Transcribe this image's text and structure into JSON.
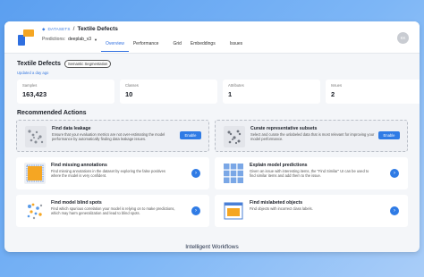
{
  "app": {
    "breadcrumb_link": "DATASETS",
    "breadcrumb_sep": "/",
    "dataset_title": "Textile Defects",
    "predictions_label": "Predictions:",
    "predictions_value": "deeplab_v3",
    "avatar_initials": "KK"
  },
  "tabs": [
    {
      "label": "Overview",
      "active": true
    },
    {
      "label": "Performance",
      "active": false
    },
    {
      "label": "Grid",
      "active": false
    },
    {
      "label": "Embeddings",
      "active": false
    },
    {
      "label": "Issues",
      "active": false
    }
  ],
  "dataset": {
    "name": "Textile Defects",
    "task_badge": "Semantic Segmentation",
    "updated": "Updated a day ago"
  },
  "stats": [
    {
      "label": "Samples",
      "value": "163,423"
    },
    {
      "label": "Classes",
      "value": "10"
    },
    {
      "label": "Attributes",
      "value": "1"
    },
    {
      "label": "Issues",
      "value": "2"
    }
  ],
  "recommended": {
    "title": "Recommended Actions",
    "cards": [
      {
        "title": "Find data leakage",
        "desc": "Ensure that your evaluation metrics are not over-estimating the model performance by automatically finding data leakage issues.",
        "action": "Enable",
        "icon": "scatter-gray-icon"
      },
      {
        "title": "Curate representative subsets",
        "desc": "Select and curate the unlabeled data that is most relevant for improving your model performance.",
        "action": "Enable",
        "icon": "scatter-cluster-icon"
      },
      {
        "title": "Find missing annotations",
        "desc": "Find missing annotations in the dataset by exploring the false positives where the model is very confident.",
        "action": "arrow",
        "icon": "missing-annotation-icon"
      },
      {
        "title": "Explain model predictions",
        "desc": "Given an issue with interesting items, the \"Find Similar\" UI can be used to find similar items and add them to the issue.",
        "action": "arrow",
        "icon": "grid-tiles-icon"
      },
      {
        "title": "Find model blind spots",
        "desc": "Find which spurious correlation your model is relying on to make predictions, which may harm generalization and lead to blind spots.",
        "action": "arrow",
        "icon": "scatter-color-icon"
      },
      {
        "title": "Find mislabeted objects",
        "desc": "Find objects with incorrect class labels.",
        "action": "arrow",
        "icon": "mislabel-frame-icon"
      }
    ]
  },
  "caption": "Intelligent Workflows",
  "colors": {
    "accent": "#2f7be5",
    "orange": "#f5a623"
  }
}
